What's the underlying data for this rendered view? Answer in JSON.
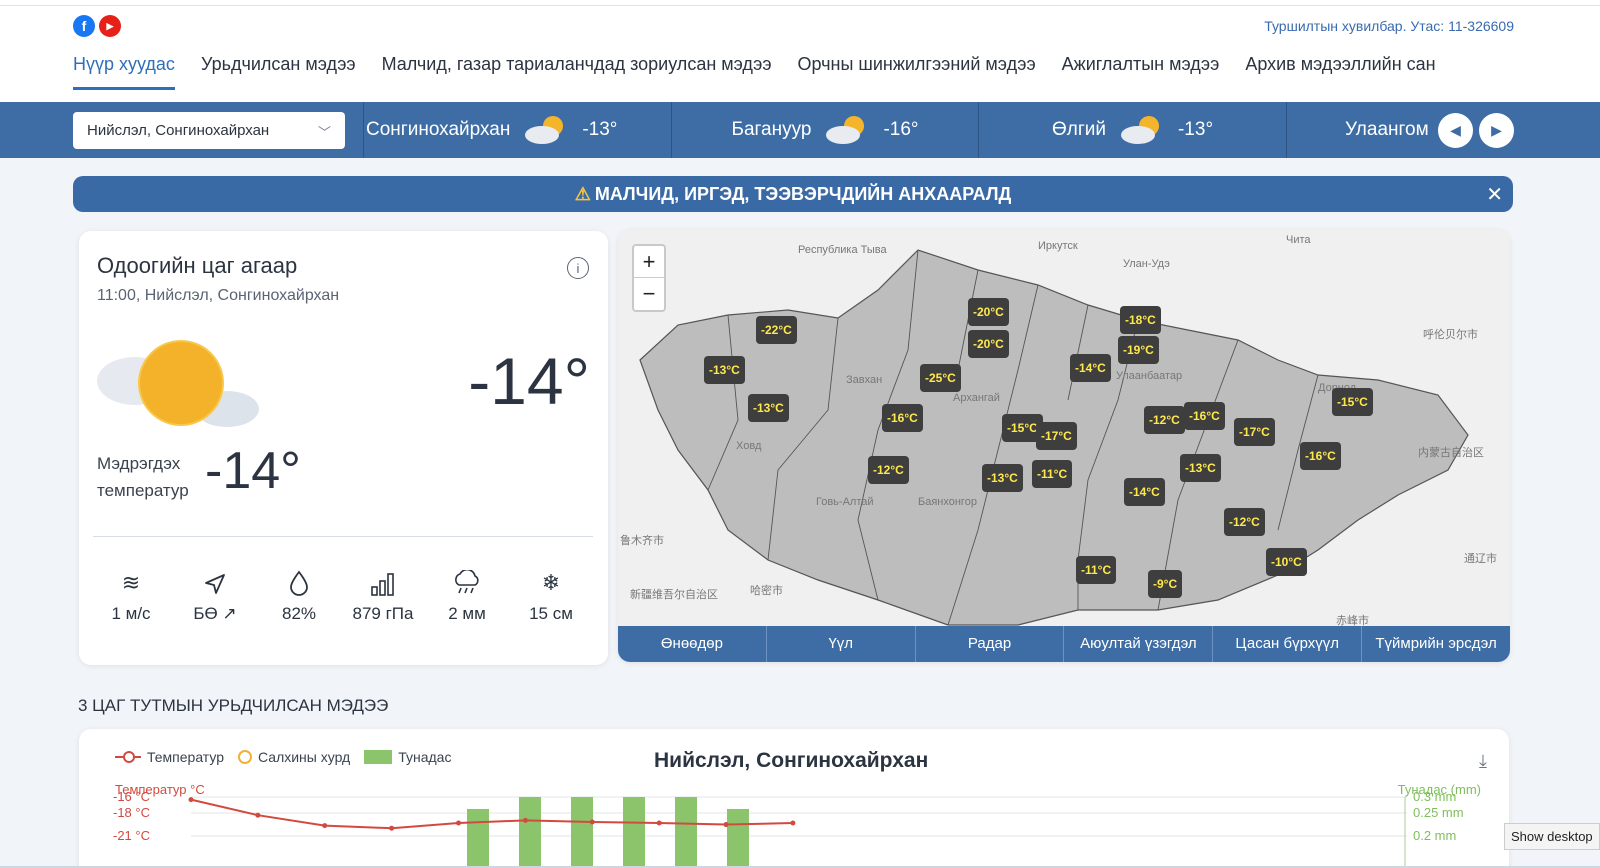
{
  "header": {
    "contact": "Туршилтын хувилбар. Утас: 11-326609",
    "nav": [
      {
        "label": "Нүүр хуудас",
        "active": true
      },
      {
        "label": "Урьдчилсан мэдээ",
        "active": false
      },
      {
        "label": "Малчид, газар тариаланчдад зориулсан мэдээ",
        "active": false
      },
      {
        "label": "Орчны шинжилгээний мэдээ",
        "active": false
      },
      {
        "label": "Ажиглалтын мэдээ",
        "active": false
      },
      {
        "label": "Архив мэдээллийн сан",
        "active": false
      }
    ]
  },
  "citybar": {
    "selected": "Нийслэл, Сонгинохайрхан",
    "cities": [
      {
        "name": "Сонгинохайрхан",
        "temp": "-13°",
        "icon": "partly-cloudy-icon"
      },
      {
        "name": "Багануур",
        "temp": "-16°",
        "icon": "partly-cloudy-icon"
      },
      {
        "name": "Өлгий",
        "temp": "-13°",
        "icon": "partly-cloudy-icon"
      },
      {
        "name": "Улаангом",
        "temp": "",
        "icon": ""
      }
    ]
  },
  "alert": {
    "text": "МАЛЧИД, ИРГЭД, ТЭЭВЭРЧДИЙН АНХААРАЛД"
  },
  "current": {
    "title": "Одоогийн цаг агаар",
    "subtitle": "11:00, Нийслэл, Сонгинохайрхан",
    "temp": "-14°",
    "feels_label": "Мэдрэгдэх температур",
    "feels_value": "-14°",
    "stats": [
      {
        "icon": "wind-icon",
        "value": "1 м/с"
      },
      {
        "icon": "direction-icon",
        "value": "БӨ ↗"
      },
      {
        "icon": "humidity-icon",
        "value": "82%"
      },
      {
        "icon": "pressure-icon",
        "value": "879 гПа"
      },
      {
        "icon": "rain-icon",
        "value": "2 мм"
      },
      {
        "icon": "snowflake-icon",
        "value": "15 см"
      }
    ]
  },
  "map": {
    "labels": [
      "Республика Тыва",
      "Иркутск",
      "Улан-Удэ",
      "Чита",
      "呼伦贝尔市",
      "Завхан",
      "Архангай",
      "Улаанбаатар",
      "Дорнод",
      "Ховд",
      "Говь-Алтай",
      "Баянхонгор",
      "内蒙古自治区",
      "通辽市",
      "新疆维吾尔自治区",
      "哈密市",
      "赤峰市",
      "鲁木齐市"
    ],
    "markers": [
      "-22°C",
      "-13°C",
      "-13°C",
      "-20°C",
      "-20°C",
      "-25°C",
      "-16°C",
      "-12°C",
      "-18°C",
      "-19°C",
      "-14°C",
      "-15°C",
      "-17°C",
      "-11°C",
      "-13°C",
      "-12°C",
      "-16°C",
      "-17°C",
      "-14°C",
      "-13°C",
      "-15°C",
      "-16°C",
      "-12°C",
      "-11°C",
      "-9°C",
      "-10°C"
    ],
    "tabs": [
      "Өнөөдөр",
      "Үүл",
      "Радар",
      "Аюултай үзэгдэл",
      "Цасан бүрхүүл",
      "Түймрийн эрсдэл"
    ]
  },
  "forecast": {
    "section_title": "3 ЦАГ ТУТМЫН УРЬДЧИЛСАН МЭДЭЭ",
    "chart_title": "Нийслэл, Сонгинохайрхан",
    "legend": {
      "temp": "Температур",
      "wind": "Салхины хурд",
      "precip": "Тунадас"
    },
    "ylabel_left": "Температур °C",
    "ylabel_right": "Тунадас (mm)"
  },
  "chart_data": {
    "type": "bar",
    "title": "Нийслэл, Сонгинохайрхан",
    "ylabel": "Температур °C",
    "y2label": "Тунадас (mm)",
    "y_ticks": [
      "-16 °C",
      "-18 °C",
      "-21 °C"
    ],
    "y2_ticks": [
      "0.3 mm",
      "0.25 mm",
      "0.2 mm"
    ],
    "series": [
      {
        "name": "Температур",
        "type": "line",
        "values": [
          -16.5,
          -19.5,
          -21.5,
          -22,
          -21,
          -20.5,
          -20.8,
          -21,
          -21.3,
          -21
        ]
      },
      {
        "name": "Тунадас",
        "type": "bar",
        "values": [
          0,
          0,
          0,
          0,
          0.2,
          0.3,
          0.3,
          0.3,
          0.3,
          0.2
        ]
      }
    ]
  },
  "tooltip": "Show desktop",
  "colors": {
    "primary": "#3d6da4",
    "accent": "#2f6fb8",
    "temp": "#d24a3f",
    "precip": "#8cc46b",
    "wind": "#f2b135"
  }
}
